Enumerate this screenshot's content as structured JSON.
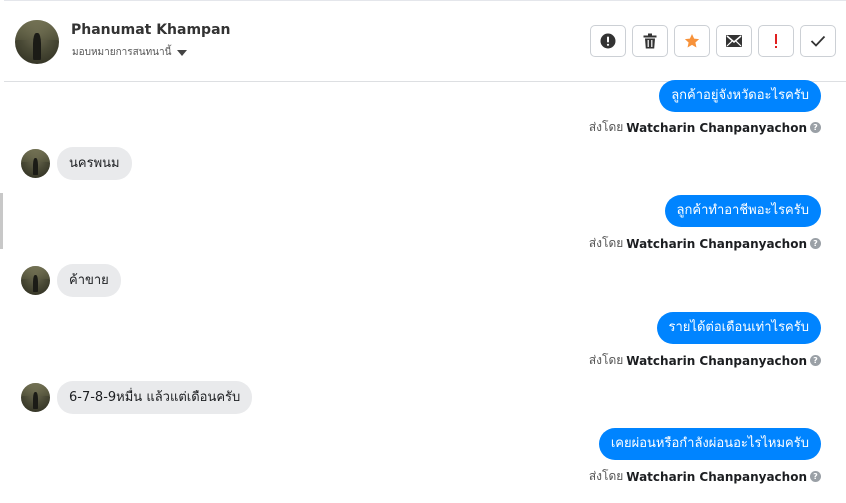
{
  "header": {
    "contact_name": "Phanumat Khampan",
    "assign_label": "มอบหมายการสนทนานี้",
    "actions": [
      {
        "name": "report-button",
        "icon": "exclamation-circle-icon"
      },
      {
        "name": "delete-button",
        "icon": "trash-icon"
      },
      {
        "name": "star-button",
        "icon": "star-icon",
        "color": "#f7923a"
      },
      {
        "name": "mark-unread-button",
        "icon": "envelope-icon"
      },
      {
        "name": "spam-button",
        "icon": "exclamation-icon",
        "color": "#e02020"
      },
      {
        "name": "done-button",
        "icon": "check-icon"
      }
    ]
  },
  "colors": {
    "outgoing_bubble": "#0084ff",
    "incoming_bubble": "#e9eaec"
  },
  "messages": [
    {
      "direction": "out",
      "text": "ลูกค้าอยู่จังหวัดอะไรครับ",
      "sent_by_prefix": "ส่งโดย",
      "sender": "Watcharin Chanpanyachon"
    },
    {
      "direction": "in",
      "text": "นครพนม"
    },
    {
      "direction": "out",
      "text": "ลูกค้าทำอาชีพอะไรครับ",
      "sent_by_prefix": "ส่งโดย",
      "sender": "Watcharin Chanpanyachon"
    },
    {
      "direction": "in",
      "text": "ค้าขาย"
    },
    {
      "direction": "out",
      "text": "รายได้ต่อเดือนเท่าไรครับ",
      "sent_by_prefix": "ส่งโดย",
      "sender": "Watcharin Chanpanyachon"
    },
    {
      "direction": "in",
      "text": "6-7-8-9หมื่น แล้วแต่เดือนครับ"
    },
    {
      "direction": "out",
      "text": "เคยผ่อนหรือกำลังผ่อนอะไรไหมครับ",
      "sent_by_prefix": "ส่งโดย",
      "sender": "Watcharin Chanpanyachon"
    }
  ]
}
